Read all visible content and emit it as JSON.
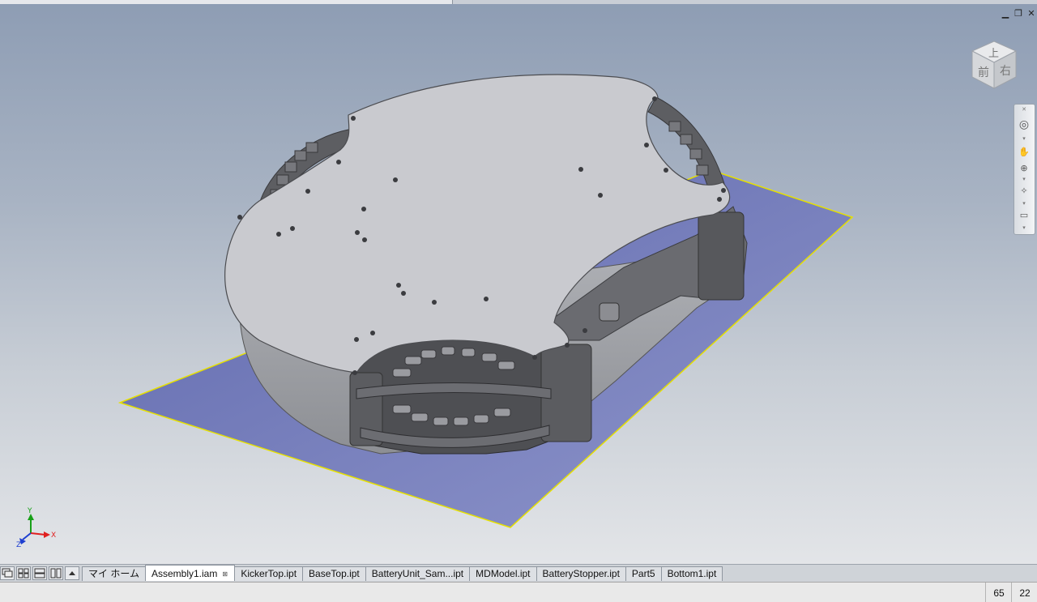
{
  "window_controls": {
    "minimize": "▁",
    "restore": "❐",
    "close": "✕"
  },
  "viewcube": {
    "top_face": "上",
    "front_face": "前",
    "right_face": "右"
  },
  "navbar_icons": [
    "steering-wheel-icon",
    "pan-icon",
    "zoom-icon",
    "orbit-icon",
    "look-at-icon"
  ],
  "triad": {
    "x_label": "X",
    "y_label": "Y",
    "z_label": "Z",
    "x_color": "#e02020",
    "y_color": "#18a018",
    "z_color": "#1e3fd0"
  },
  "tabs": [
    {
      "label": "マイ ホーム",
      "active": false
    },
    {
      "label": "Assembly1.iam",
      "active": true,
      "close": "⊠"
    },
    {
      "label": "KickerTop.ipt",
      "active": false
    },
    {
      "label": "BaseTop.ipt",
      "active": false
    },
    {
      "label": "BatteryUnit_Sam...ipt",
      "active": false
    },
    {
      "label": "MDModel.ipt",
      "active": false
    },
    {
      "label": "BatteryStopper.ipt",
      "active": false
    },
    {
      "label": "Part5",
      "active": false
    },
    {
      "label": "Bottom1.ipt",
      "active": false
    }
  ],
  "status": {
    "message": "",
    "occurrences": "65",
    "open_documents": "22"
  },
  "colors": {
    "ground_plane": "#6b73b4",
    "ground_edge": "#e6e000",
    "part_top": "#c9cacf",
    "part_dark": "#5a5b5f"
  }
}
